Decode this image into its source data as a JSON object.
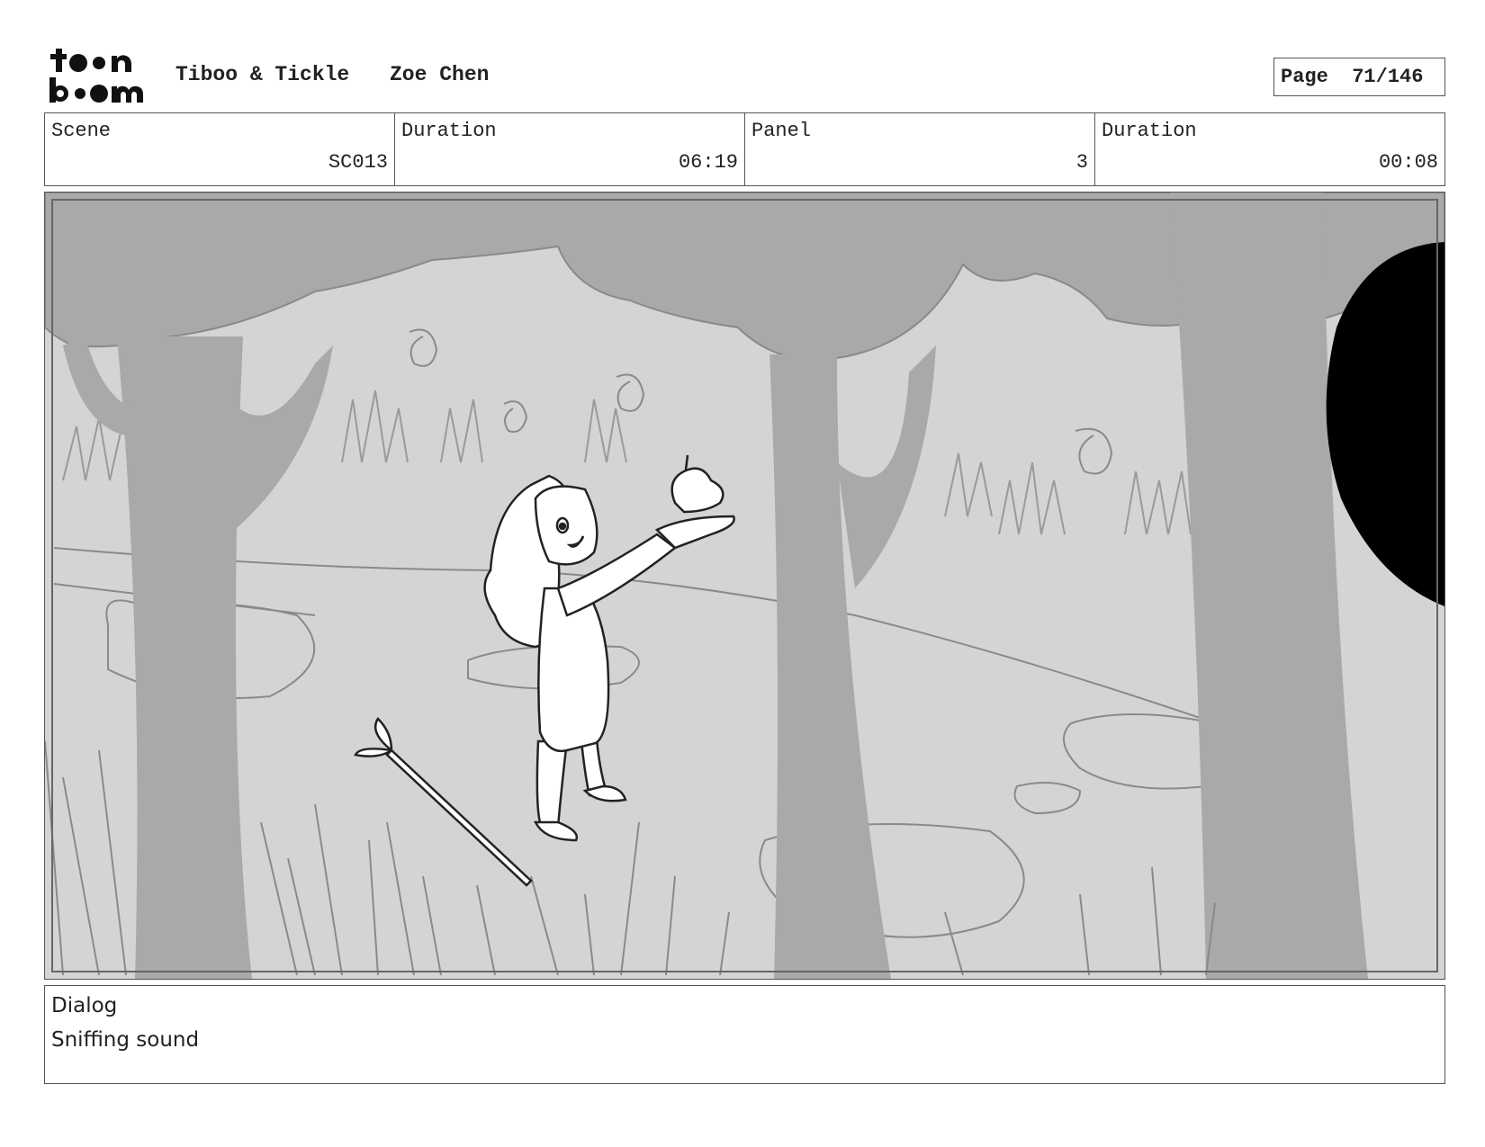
{
  "header": {
    "project_title": "Tiboo & Tickle",
    "author": "Zoe Chen",
    "page_label": "Page",
    "page_value": "71/146"
  },
  "logo": {
    "name": "toon-boom-logo",
    "text": "toon boom"
  },
  "info": {
    "scene_label": "Scene",
    "scene_value": "SC013",
    "scene_duration_label": "Duration",
    "scene_duration_value": "06:19",
    "panel_label": "Panel",
    "panel_value": "3",
    "panel_duration_label": "Duration",
    "panel_duration_value": "00:08"
  },
  "dialog": {
    "label": "Dialog",
    "text": "Sniffing sound"
  }
}
